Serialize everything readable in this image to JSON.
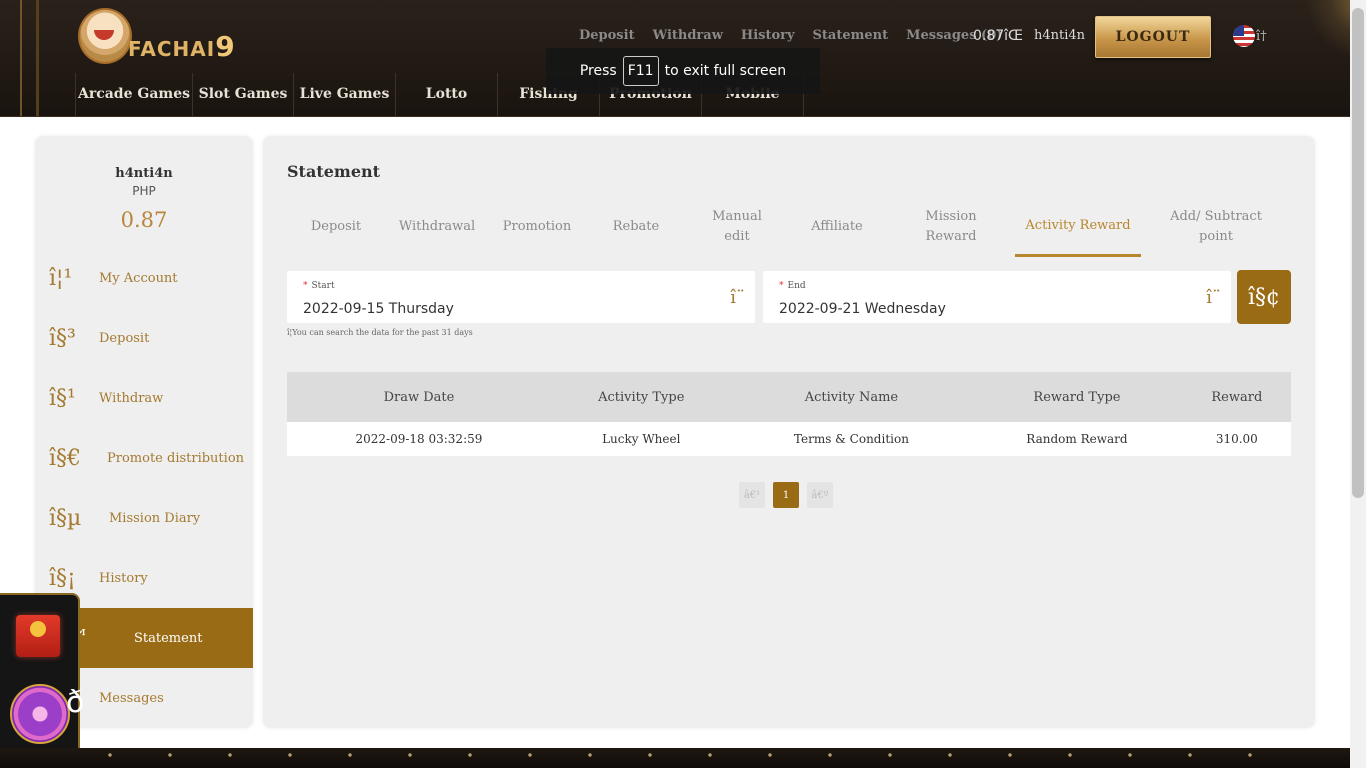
{
  "header": {
    "logo_text": "FACHAI",
    "logo_number": "9",
    "topnav": [
      "Deposit",
      "Withdraw",
      "History",
      "Statement",
      "Messages (0)"
    ],
    "balance": "0.87",
    "balance_icon": "îŒ",
    "username": "h4nti4n",
    "logout_label": "LOGOUT",
    "lang_glyph": "î†",
    "mainnav": [
      "Arcade Games",
      "Slot Games",
      "Live Games",
      "Lotto",
      "Fishing",
      "Promotion",
      "Mobile"
    ]
  },
  "fullscreen_toast": {
    "press": "Press",
    "key": "F11",
    "rest": "to exit full screen"
  },
  "sidebar": {
    "username": "h4nti4n",
    "currency": "PHP",
    "balance": "0.87",
    "items": [
      {
        "icon": "î¦¹",
        "label": "My Account"
      },
      {
        "icon": "î§³",
        "label": "Deposit"
      },
      {
        "icon": "î§¹",
        "label": "Withdraw"
      },
      {
        "icon": "î§€",
        "label": "Promote distribution"
      },
      {
        "icon": "î§µ",
        "label": "Mission Diary"
      },
      {
        "icon": "î§¡",
        "label": "History"
      },
      {
        "icon": "î§™",
        "label": "Statement"
      },
      {
        "icon": "î§",
        "label": "Messages"
      }
    ]
  },
  "main": {
    "title": "Statement",
    "tabs": [
      "Deposit",
      "Withdrawal",
      "Promotion",
      "Rebate",
      "Manual edit",
      "Affiliate",
      "Mission Reward",
      "Activity Reward",
      "Add/ Subtract point"
    ],
    "active_tab": "Activity Reward",
    "start_label": "Start",
    "start_value": "2022-09-15 Thursday",
    "end_label": "End",
    "end_value": "2022-09-21 Wednesday",
    "calendar_glyph": "î¨",
    "search_glyph": "î§¢",
    "hint": "î¦You can search the data for the past 31 days",
    "table": {
      "headers": [
        "Draw Date",
        "Activity Type",
        "Activity Name",
        "Reward Type",
        "Reward"
      ],
      "rows": [
        [
          "2022-09-18 03:32:59",
          "Lucky Wheel",
          "Terms & Condition",
          "Random Reward",
          "310.00"
        ]
      ]
    },
    "pager": {
      "prev": "â€¹",
      "current": "1",
      "next": "â€º"
    }
  },
  "floating": {
    "search_glyph": "ð"
  },
  "colors": {
    "accent": "#9a6b15",
    "gold": "#b8862e",
    "header_bg": "#1f1812"
  }
}
